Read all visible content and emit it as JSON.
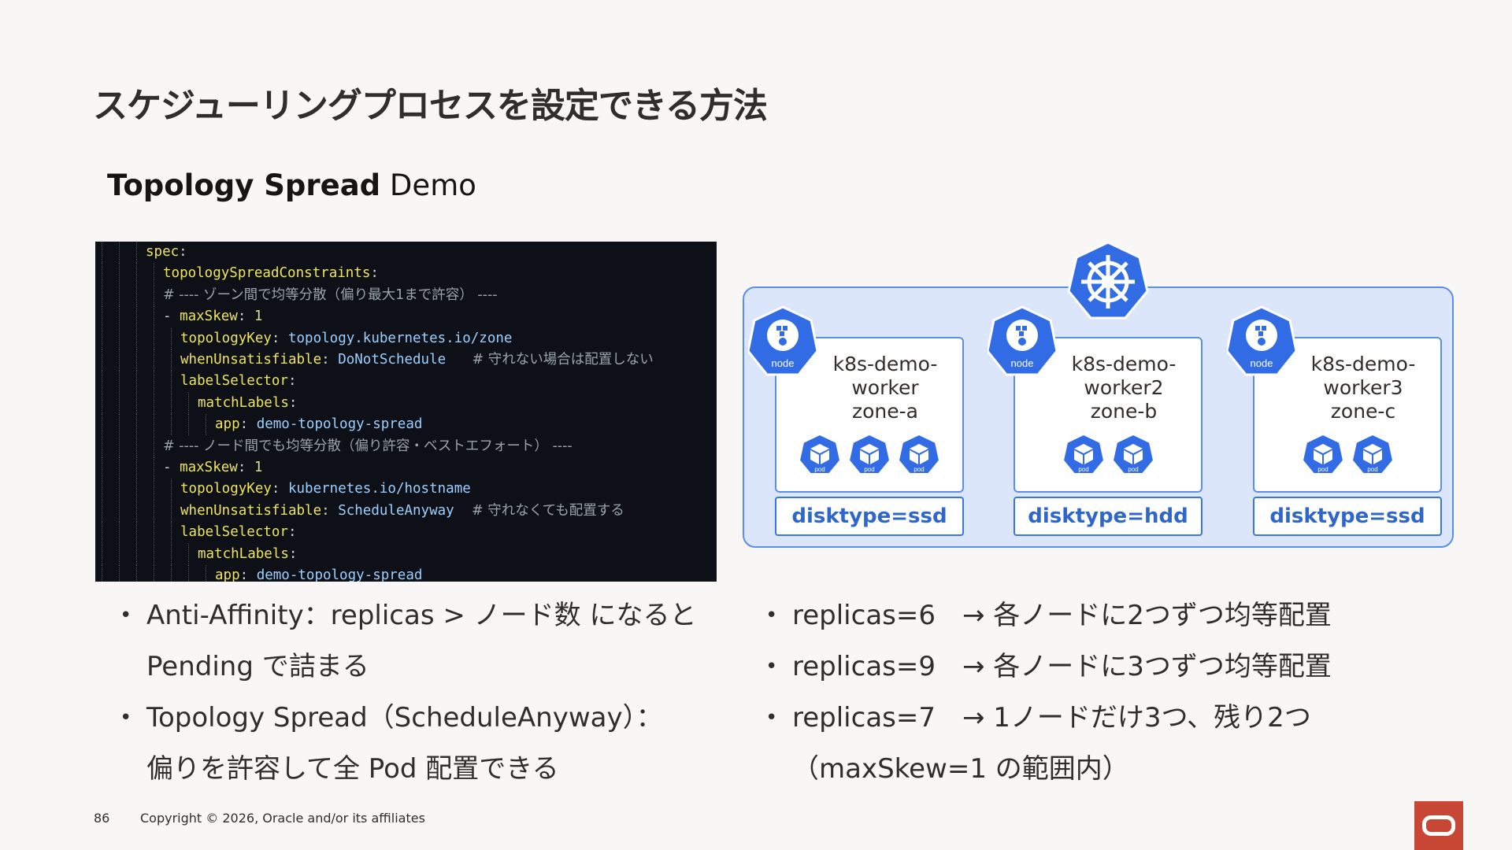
{
  "slide": {
    "title": "スケジューリングプロセスを設定できる方法",
    "subtitle_bold": "Topology Spread",
    "subtitle_rest": " Demo"
  },
  "code_lines": [
    {
      "indent": 3,
      "parts": [
        {
          "c": "k",
          "t": "spec"
        },
        {
          "c": "p",
          "t": ":"
        }
      ]
    },
    {
      "indent": 4,
      "parts": [
        {
          "c": "k",
          "t": "topologySpreadConstraints"
        },
        {
          "c": "p",
          "t": ":"
        }
      ]
    },
    {
      "indent": 4,
      "parts": [
        {
          "c": "c",
          "t": "# ---- ゾーン間で均等分散（偏り最大1まで許容） ----"
        }
      ]
    },
    {
      "indent": 4,
      "parts": [
        {
          "c": "p",
          "t": "- "
        },
        {
          "c": "k",
          "t": "maxSkew"
        },
        {
          "c": "p",
          "t": ": "
        },
        {
          "c": "n",
          "t": "1"
        }
      ]
    },
    {
      "indent": 5,
      "parts": [
        {
          "c": "k",
          "t": "topologyKey"
        },
        {
          "c": "p",
          "t": ": "
        },
        {
          "c": "v",
          "t": "topology.kubernetes.io/zone"
        }
      ]
    },
    {
      "indent": 5,
      "parts": [
        {
          "c": "k",
          "t": "whenUnsatisfiable"
        },
        {
          "c": "p",
          "t": ": "
        },
        {
          "c": "v",
          "t": "DoNotSchedule"
        },
        {
          "c": "c",
          "t": "      # 守れない場合は配置しない"
        }
      ]
    },
    {
      "indent": 5,
      "parts": [
        {
          "c": "k",
          "t": "labelSelector"
        },
        {
          "c": "p",
          "t": ":"
        }
      ]
    },
    {
      "indent": 6,
      "parts": [
        {
          "c": "k",
          "t": "matchLabels"
        },
        {
          "c": "p",
          "t": ":"
        }
      ]
    },
    {
      "indent": 7,
      "parts": [
        {
          "c": "k",
          "t": "app"
        },
        {
          "c": "p",
          "t": ": "
        },
        {
          "c": "v",
          "t": "demo-topology-spread"
        }
      ]
    },
    {
      "indent": 4,
      "parts": [
        {
          "c": "c",
          "t": "# ---- ノード間でも均等分散（偏り許容・ベストエフォート） ----"
        }
      ]
    },
    {
      "indent": 4,
      "parts": [
        {
          "c": "p",
          "t": "- "
        },
        {
          "c": "k",
          "t": "maxSkew"
        },
        {
          "c": "p",
          "t": ": "
        },
        {
          "c": "n",
          "t": "1"
        }
      ]
    },
    {
      "indent": 5,
      "parts": [
        {
          "c": "k",
          "t": "topologyKey"
        },
        {
          "c": "p",
          "t": ": "
        },
        {
          "c": "v",
          "t": "kubernetes.io/hostname"
        }
      ]
    },
    {
      "indent": 5,
      "parts": [
        {
          "c": "k",
          "t": "whenUnsatisfiable"
        },
        {
          "c": "p",
          "t": ": "
        },
        {
          "c": "v",
          "t": "ScheduleAnyway"
        },
        {
          "c": "c",
          "t": "    # 守れなくても配置する"
        }
      ]
    },
    {
      "indent": 5,
      "parts": [
        {
          "c": "k",
          "t": "labelSelector"
        },
        {
          "c": "p",
          "t": ":"
        }
      ]
    },
    {
      "indent": 6,
      "parts": [
        {
          "c": "k",
          "t": "matchLabels"
        },
        {
          "c": "p",
          "t": ":"
        }
      ]
    },
    {
      "indent": 7,
      "parts": [
        {
          "c": "k",
          "t": "app"
        },
        {
          "c": "p",
          "t": ": "
        },
        {
          "c": "v",
          "t": "demo-topology-spread"
        }
      ]
    }
  ],
  "cluster": {
    "node_icon_label": "node",
    "pod_icon_label": "pod",
    "nodes": [
      {
        "name": "k8s-demo-\nworker\nzone-a",
        "pods": 3,
        "label": "disktype=ssd"
      },
      {
        "name": "k8s-demo-\nworker2\nzone-b",
        "pods": 2,
        "label": "disktype=hdd"
      },
      {
        "name": "k8s-demo-\nworker3\nzone-c",
        "pods": 2,
        "label": "disktype=ssd"
      }
    ]
  },
  "bullets_left": {
    "item1_line1": "Anti-Affinity：replicas > ノード数 になると",
    "item1_line2": "Pending で詰まる",
    "item2_line1": "Topology Spread（ScheduleAnyway）：",
    "item2_line2": "偏りを許容して全 Pod 配置できる"
  },
  "bullets_right": {
    "item1": "replicas=6　→ 各ノードに2つずつ均等配置",
    "item2": "replicas=9　→ 各ノードに3つずつ均等配置",
    "item3_line1": "replicas=7　→ 1ノードだけ3つ、残り2つ",
    "item3_line2": "（maxSkew=1 の範囲内）"
  },
  "bullet_symbol": "•",
  "footer": {
    "page_number": "86",
    "copyright": "Copyright © 2026, Oracle and/or its affiliates"
  },
  "colors": {
    "accent_blue": "#326ce5",
    "oracle_red": "#c74634"
  }
}
